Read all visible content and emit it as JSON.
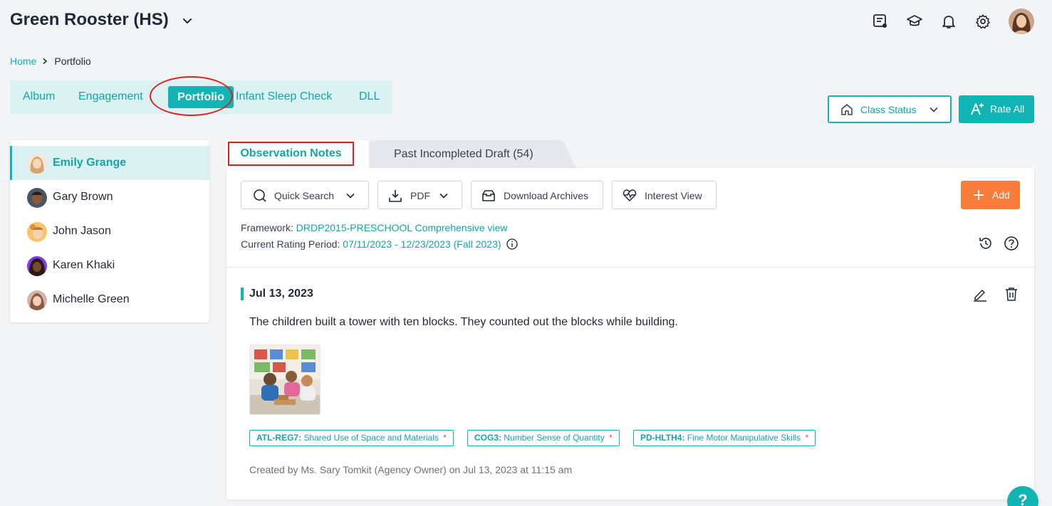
{
  "header": {
    "org_name": "Green Rooster (HS)",
    "icons": [
      "messages-icon",
      "graduation-cap-icon",
      "bell-icon",
      "gear-icon",
      "user-avatar"
    ]
  },
  "breadcrumb": {
    "home": "Home",
    "current": "Portfolio"
  },
  "module_tabs": {
    "items": [
      "Album",
      "Engagement",
      "Portfolio",
      "Infant Sleep Check",
      "DLL"
    ],
    "active": "Portfolio"
  },
  "actions": {
    "class_status": "Class Status",
    "rate_all": "Rate All"
  },
  "children": [
    {
      "name": "Emily Grange",
      "active": true
    },
    {
      "name": "Gary Brown",
      "active": false
    },
    {
      "name": "John Jason",
      "active": false
    },
    {
      "name": "Karen Khaki",
      "active": false
    },
    {
      "name": "Michelle Green",
      "active": false
    }
  ],
  "content_tabs": {
    "observation_notes": "Observation Notes",
    "past_drafts": "Past Incompleted Draft (54)"
  },
  "toolbar": {
    "quick_search": "Quick Search",
    "pdf": "PDF",
    "download_archives": "Download Archives",
    "interest_view": "Interest View",
    "add": "Add"
  },
  "framework": {
    "label": "Framework:",
    "value": "DRDP2015-PRESCHOOL Comprehensive view"
  },
  "rating_period": {
    "label": "Current Rating Period:",
    "value": "07/11/2023 - 12/23/2023 (Fall 2023)"
  },
  "note": {
    "date": "Jul 13, 2023",
    "text": "The children built a tower with ten blocks. They counted out the blocks while building.",
    "tags": [
      {
        "code": "ATL-REG7:",
        "desc": "Shared Use of Space and Materials"
      },
      {
        "code": "COG3:",
        "desc": "Number Sense of Quantity"
      },
      {
        "code": "PD-HLTH4:",
        "desc": "Fine Motor Manipulative Skills"
      }
    ],
    "required_mark": "*",
    "created_by": "Created by Ms. Sary Tomkit (Agency Owner) on Jul 13, 2023 at 11:15 am"
  },
  "floating_help": "?",
  "colors": {
    "accent": "#12b3b5",
    "add_button": "#fb7d3c",
    "highlight_red": "#e02020"
  }
}
